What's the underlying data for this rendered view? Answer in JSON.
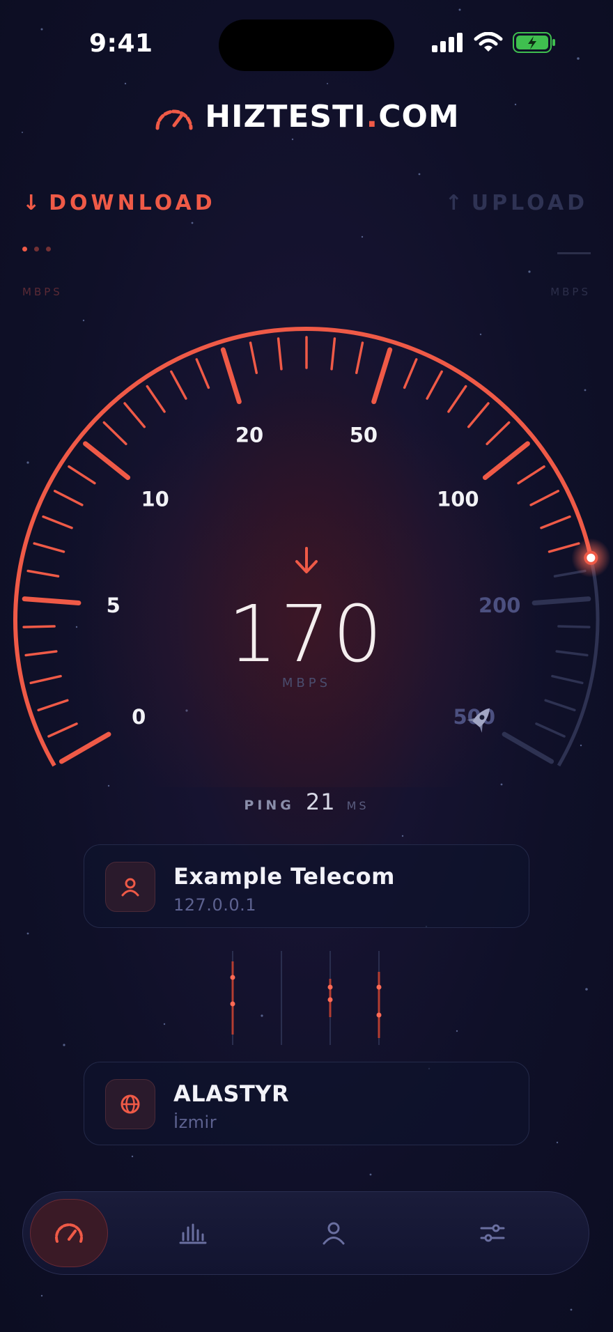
{
  "status_bar": {
    "time": "9:41"
  },
  "brand": {
    "name_main": "HIZTESTI",
    "name_dot": ".",
    "name_tld": "COM"
  },
  "modes": {
    "download_arrow": "↓",
    "download_label": "DOWNLOAD",
    "upload_arrow": "↑",
    "upload_label": "UPLOAD",
    "download_unit": "MBPS",
    "upload_unit": "MBPS"
  },
  "gauge": {
    "scale_labels": [
      "0",
      "5",
      "10",
      "20",
      "50",
      "100",
      "200",
      "500"
    ],
    "current_value": 170,
    "accent_color": "#ef5a47",
    "inactive_color": "#2e3252"
  },
  "speed": {
    "value": "170",
    "unit": "MBPS"
  },
  "ping": {
    "label": "PING",
    "value": "21",
    "unit": "MS"
  },
  "isp_card": {
    "title": "Example Telecom",
    "subtitle": "127.0.0.1",
    "icon": "user-icon"
  },
  "server_card": {
    "title": "ALASTYR",
    "subtitle": "İzmir",
    "icon": "globe-icon"
  },
  "nav": {
    "items": [
      {
        "icon": "speedometer-icon",
        "active": true
      },
      {
        "icon": "bar-chart-icon",
        "active": false
      },
      {
        "icon": "profile-icon",
        "active": false
      },
      {
        "icon": "sliders-icon",
        "active": false
      }
    ]
  }
}
